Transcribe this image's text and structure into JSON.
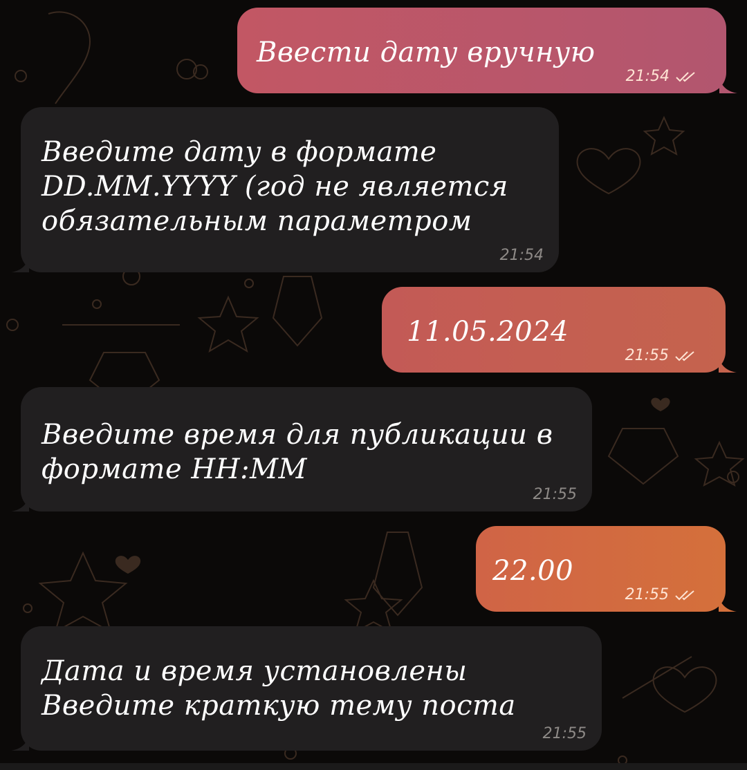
{
  "messages": [
    {
      "direction": "outgoing",
      "text": "Ввести дату вручную",
      "time": "21:54",
      "status_icon": "double-check-icon"
    },
    {
      "direction": "incoming",
      "text": "Введите дату в формате\nDD.MM.YYYY (год не является\nобязательным параметром",
      "time": "21:54"
    },
    {
      "direction": "outgoing",
      "text": "11.05.2024",
      "time": "21:55",
      "status_icon": "double-check-icon"
    },
    {
      "direction": "incoming",
      "text": "Введите время для публикации в\nформате HH:MM",
      "time": "21:55"
    },
    {
      "direction": "outgoing",
      "text": "22.00",
      "time": "21:55",
      "status_icon": "double-check-icon"
    },
    {
      "direction": "incoming",
      "text": "Дата и время установлены\nВведите краткую тему поста",
      "time": "21:55"
    }
  ],
  "colors": {
    "background": "#0b0908",
    "incoming_bubble": "#211f20",
    "outgoing_pink": "#c25764",
    "outgoing_coral": "#c35a56",
    "outgoing_orange": "#d06446",
    "wallpaper_doodle": "#3a2a20"
  }
}
